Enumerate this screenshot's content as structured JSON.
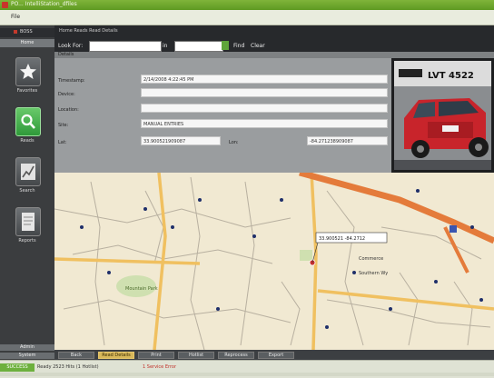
{
  "window": {
    "title": "PO... IntelliStation_dfiles"
  },
  "menubar": {
    "items_label": "File"
  },
  "sidebar": {
    "brand": "BOSS",
    "section_label": "Home",
    "items": [
      {
        "label": "Favorites",
        "icon": "star-icon"
      },
      {
        "label": "Reads",
        "icon": "magnifier-icon"
      },
      {
        "label": "Search",
        "icon": "chart-icon"
      },
      {
        "label": "Reports",
        "icon": "document-icon"
      }
    ],
    "bottom": [
      "Admin",
      "System"
    ]
  },
  "toolbar": {
    "tabs_text": "Home  Reads  Read Details",
    "look_for_label": "Look For:",
    "look_for_value": "",
    "in_label": "in",
    "in_value": "",
    "find_label": "Find",
    "clear_label": "Clear"
  },
  "details": {
    "header": "Details",
    "timestamp_label": "Timestamp:",
    "timestamp_value": "2/14/2008 4:22:45 PM",
    "device_label": "Device:",
    "device_value": "",
    "location_label": "Location:",
    "location_value": "",
    "site_label": "Site:",
    "site_value": "MANUAL ENTRIES",
    "lat_label": "Lat:",
    "lat_value": "33.900521909087",
    "lon_label": "Lon:",
    "lon_value": "-84.271238909087"
  },
  "photo": {
    "plate_text": "LVT 4522"
  },
  "map": {
    "callout_text": "33.900521 -84.2712",
    "place_labels": [
      "Commerce",
      "Southern Wy",
      "Mountain Park"
    ],
    "accent_road": "#e47b3b",
    "highway_color": "#f0c060"
  },
  "bottom_tabs": [
    {
      "label": "Back",
      "active": false
    },
    {
      "label": "Read Details",
      "active": true
    },
    {
      "label": "Print",
      "active": false
    },
    {
      "label": "Hotlist",
      "active": false
    },
    {
      "label": "Reprocess",
      "active": false
    },
    {
      "label": "Export",
      "active": false
    }
  ],
  "statusbar": {
    "left": "SUCCESS",
    "text": "Ready  2523 Hits (1 Hotlist)",
    "right": "1 Service Error"
  }
}
